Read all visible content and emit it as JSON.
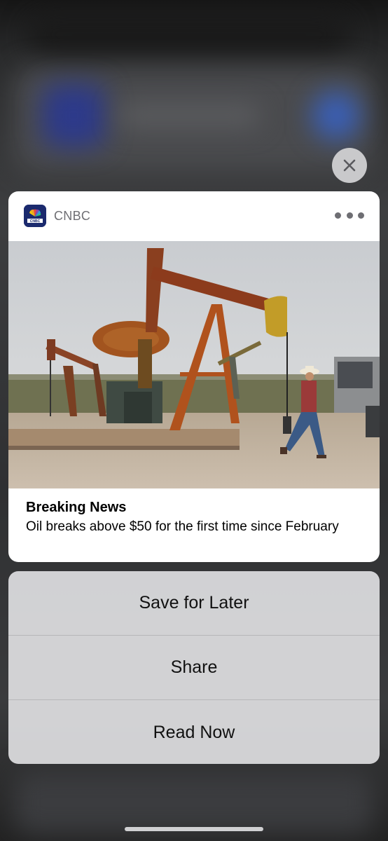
{
  "notification": {
    "app_name": "CNBC",
    "app_icon": "cnbc-peacock-icon",
    "title": "Breaking News",
    "message": "Oil breaks above $50 for the first time since February"
  },
  "actions": [
    {
      "label": "Save for Later"
    },
    {
      "label": "Share"
    },
    {
      "label": "Read Now"
    }
  ],
  "colors": {
    "card_background": "#ffffff",
    "action_sheet_background": "#dedee0",
    "secondary_text": "#6e6e73",
    "cnbc_icon_background": "#1b2a6e"
  }
}
